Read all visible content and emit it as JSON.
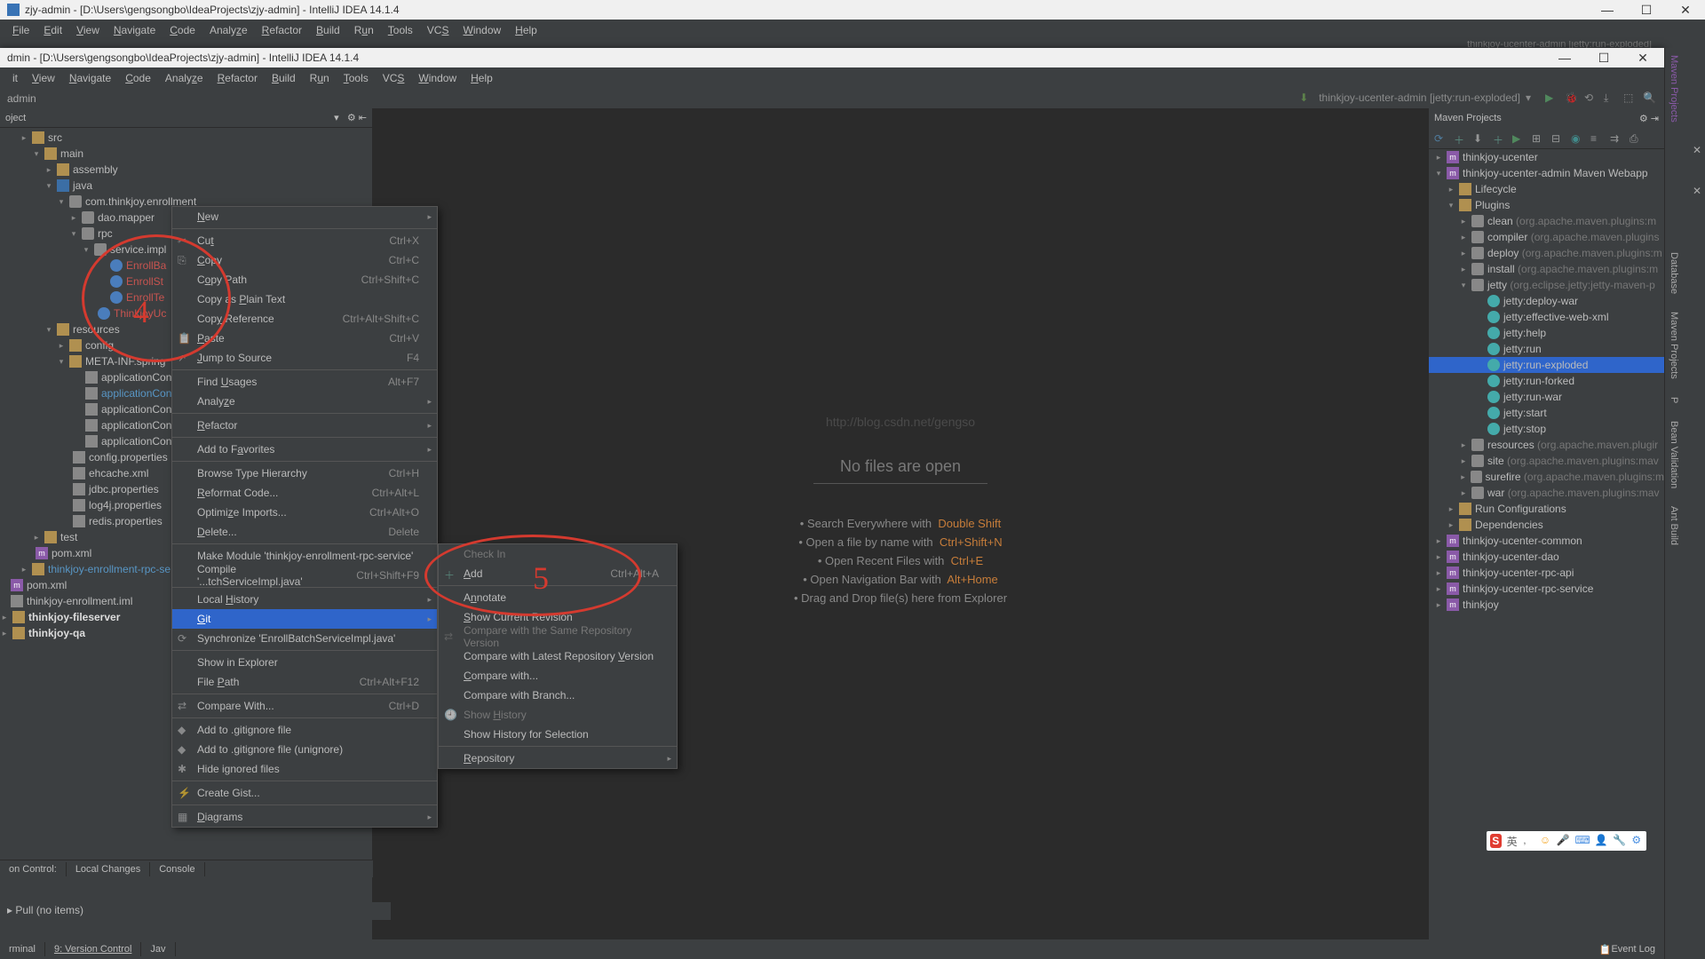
{
  "title": "zjy-admin - [D:\\Users\\gengsongbo\\IdeaProjects\\zjy-admin] - IntelliJ IDEA 14.1.4",
  "inner_title": "dmin - [D:\\Users\\gengsongbo\\IdeaProjects\\zjy-admin] - IntelliJ IDEA 14.1.4",
  "menus": [
    "File",
    "Edit",
    "View",
    "Navigate",
    "Code",
    "Analyze",
    "Refactor",
    "Build",
    "Run",
    "Tools",
    "VCS",
    "Window",
    "Help"
  ],
  "breadcrumb": "admin",
  "run_config": "thinkjoy-ucenter-admin [jetty:run-exploded]",
  "run_config_outer": "thinkjoy-ucenter-admin [jetty:run-exploded]",
  "project_header": "oject",
  "tree": {
    "src": "src",
    "main": "main",
    "assembly": "assembly",
    "java": "java",
    "pkg": "com.thinkjoy.enrollment",
    "dao": "dao.mapper",
    "rpc": "rpc",
    "service": "service.impl",
    "f1": "EnrollBa",
    "f2": "EnrollSt",
    "f3": "EnrollTe",
    "f4": "ThinkjoyUc",
    "resources": "resources",
    "config": "config",
    "metainf": "META-INF.spring",
    "ac1": "applicationCont",
    "ac2": "applicationCont",
    "ac3": "applicationCont",
    "ac4": "applicationCont",
    "ac5": "applicationCont",
    "cp": "config.properties",
    "eh": "ehcache.xml",
    "jd": "jdbc.properties",
    "l4": "log4j.properties",
    "rd": "redis.properties",
    "test": "test",
    "pom1": "pom.xml",
    "svc": "thinkjoy-enrollment-rpc-se",
    "pom2": "pom.xml",
    "iml": "thinkjoy-enrollment.iml",
    "fs": "thinkjoy-fileserver",
    "qa": "thinkjoy-qa"
  },
  "editor": {
    "no_files": "No files are open",
    "t1a": "Search Everywhere with",
    "t1b": "Double Shift",
    "t2a": "Open a file by name with",
    "t2b": "Ctrl+Shift+N",
    "t3a": "Open Recent Files with",
    "t3b": "Ctrl+E",
    "t4a": "Open Navigation Bar with",
    "t4b": "Alt+Home",
    "t5": "Drag and Drop file(s) here from Explorer",
    "wm": "http://blog.csdn.net/gengso"
  },
  "maven_header": "Maven Projects",
  "maven": {
    "uc": "thinkjoy-ucenter",
    "admin": "thinkjoy-ucenter-admin Maven Webapp",
    "lifecycle": "Lifecycle",
    "plugins": "Plugins",
    "clean": "clean",
    "clean_g": "(org.apache.maven.plugins:m",
    "compiler": "compiler",
    "compiler_g": "(org.apache.maven.plugins",
    "deploy": "deploy",
    "deploy_g": "(org.apache.maven.plugins:m",
    "install": "install",
    "install_g": "(org.apache.maven.plugins:m",
    "jetty": "jetty",
    "jetty_g": "(org.eclipse.jetty:jetty-maven-p",
    "j1": "jetty:deploy-war",
    "j2": "jetty:effective-web-xml",
    "j3": "jetty:help",
    "j4": "jetty:run",
    "j5": "jetty:run-exploded",
    "j6": "jetty:run-forked",
    "j7": "jetty:run-war",
    "j8": "jetty:start",
    "j9": "jetty:stop",
    "res": "resources",
    "res_g": "(org.apache.maven.plugir",
    "site": "site",
    "site_g": "(org.apache.maven.plugins:mav",
    "sf": "surefire",
    "sf_g": "(org.apache.maven.plugins:m",
    "war": "war",
    "war_g": "(org.apache.maven.plugins:mav",
    "rc": "Run Configurations",
    "dep": "Dependencies",
    "m1": "thinkjoy-ucenter-common",
    "m2": "thinkjoy-ucenter-dao",
    "m3": "thinkjoy-ucenter-rpc-api",
    "m4": "thinkjoy-ucenter-rpc-service",
    "m5": "thinkjoy"
  },
  "ctx": {
    "new": "New",
    "cut": "Cut",
    "cut_sc": "Ctrl+X",
    "copy": "Copy",
    "copy_sc": "Ctrl+C",
    "copypath": "Copy Path",
    "copypath_sc": "Ctrl+Shift+C",
    "copyplain": "Copy as Plain Text",
    "copyref": "Copy Reference",
    "copyref_sc": "Ctrl+Alt+Shift+C",
    "paste": "Paste",
    "paste_sc": "Ctrl+V",
    "jump": "Jump to Source",
    "jump_sc": "F4",
    "usages": "Find Usages",
    "usages_sc": "Alt+F7",
    "analyze": "Analyze",
    "refactor": "Refactor",
    "fav": "Add to Favorites",
    "hier": "Browse Type Hierarchy",
    "hier_sc": "Ctrl+H",
    "reformat": "Reformat Code...",
    "reformat_sc": "Ctrl+Alt+L",
    "optimize": "Optimize Imports...",
    "optimize_sc": "Ctrl+Alt+O",
    "delete": "Delete...",
    "delete_sc": "Delete",
    "make": "Make Module 'thinkjoy-enrollment-rpc-service'",
    "compile": "Compile '...tchServiceImpl.java'",
    "compile_sc": "Ctrl+Shift+F9",
    "lh": "Local History",
    "git": "Git",
    "sync": "Synchronize 'EnrollBatchServiceImpl.java'",
    "explorer": "Show in Explorer",
    "fpath": "File Path",
    "fpath_sc": "Ctrl+Alt+F12",
    "compare": "Compare With...",
    "compare_sc": "Ctrl+D",
    "gi1": "Add to .gitignore file",
    "gi2": "Add to .gitignore file (unignore)",
    "hide": "Hide ignored files",
    "gist": "Create Gist...",
    "diag": "Diagrams"
  },
  "git_ctx": {
    "checkin": "Check In",
    "add": "Add",
    "add_sc": "Ctrl+Alt+A",
    "annotate": "Annotate",
    "scr": "Show Current Revision",
    "cs": "Compare with the Same Repository Version",
    "cl": "Compare with Latest Repository Version",
    "cw": "Compare with...",
    "cb": "Compare with Branch...",
    "sh": "Show History",
    "shs": "Show History for Selection",
    "repo": "Repository"
  },
  "bottom": {
    "t1": "on Control:",
    "t2": "Local Changes",
    "t3": "Console",
    "pull": "Pull (no items)",
    "b1": "rminal",
    "b2": "9: Version Control",
    "b3": "Jav",
    "event": "Event Log"
  },
  "right_tabs": {
    "mp": "Maven Projects",
    "db": "Database",
    "mp2": "Maven Projects",
    "p": "P",
    "bv": "Bean Validation",
    "ab": "Ant Build"
  }
}
